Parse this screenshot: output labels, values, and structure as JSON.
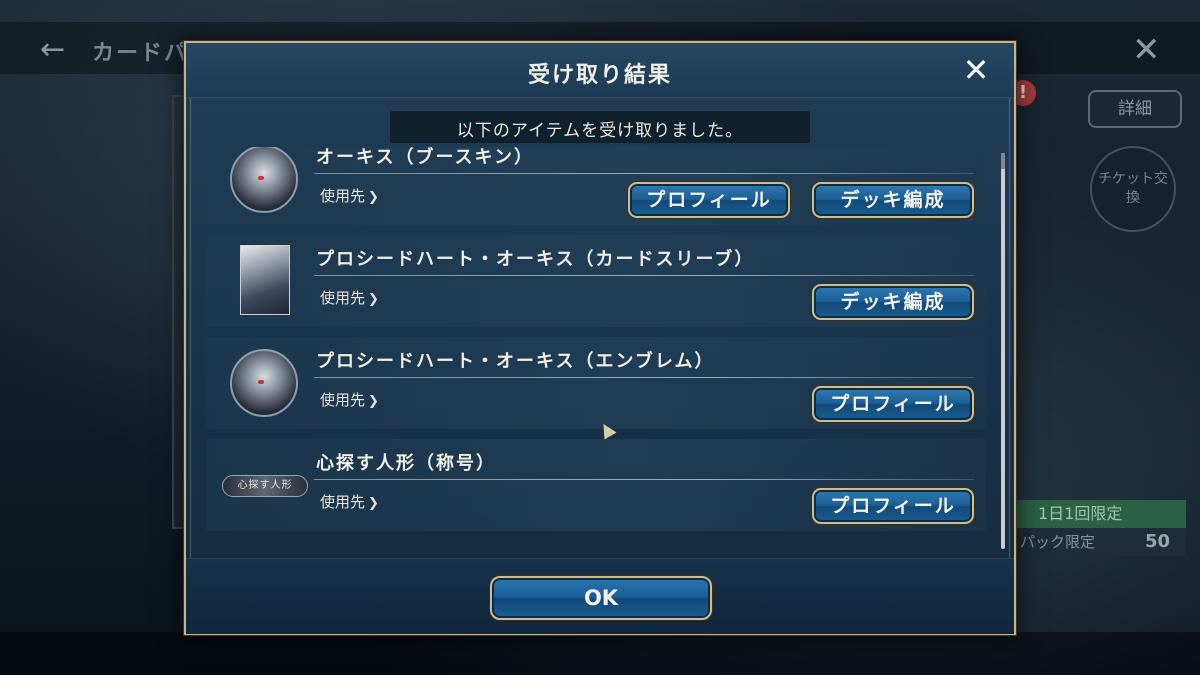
{
  "background": {
    "screen_title": "カードパ",
    "close_glyph": "✕",
    "back_glyph": "←",
    "detail_label": "詳細",
    "exchange_label": "チケット交換",
    "alert": "!",
    "limit_text": "1日1回限定",
    "pack_text": "パック限定",
    "pack_count": "50"
  },
  "modal": {
    "title": "受け取り結果",
    "close_glyph": "✕",
    "subtitle": "以下のアイテムを受け取りました。",
    "usage_label": "使用先",
    "usage_chevron": "❯",
    "items": [
      {
        "name": "オーキス（ブースキン）",
        "thumb": "avatar-portrait",
        "buttons": [
          "プロフィール",
          "デッキ編成"
        ]
      },
      {
        "name": "プロシードハート・オーキス（カードスリーブ）",
        "thumb": "card-sleeve",
        "buttons": [
          "デッキ編成"
        ]
      },
      {
        "name": "プロシードハート・オーキス（エンブレム）",
        "thumb": "emblem-portrait",
        "buttons": [
          "プロフィール"
        ]
      },
      {
        "name": "心探す人形（称号）",
        "thumb": "title-plate",
        "thumb_text": "心探す人形",
        "buttons": [
          "プロフィール"
        ]
      }
    ],
    "ok_label": "OK"
  }
}
